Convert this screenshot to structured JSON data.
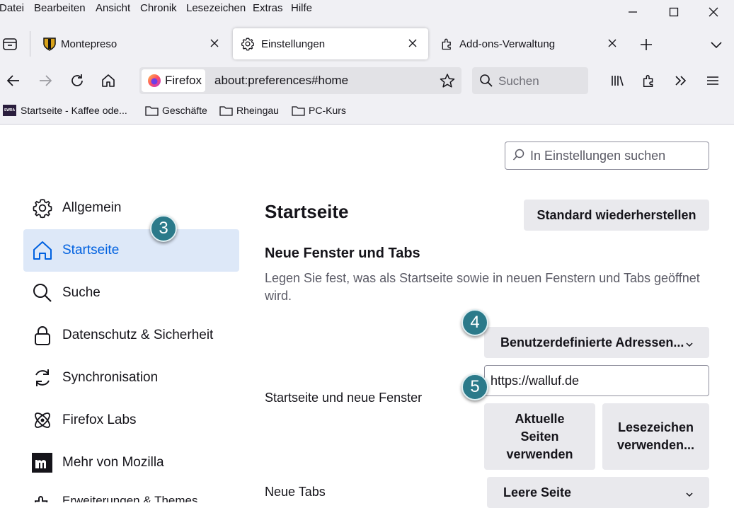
{
  "menu": [
    "Datei",
    "Bearbeiten",
    "Ansicht",
    "Chronik",
    "Lesezeichen",
    "Extras",
    "Hilfe"
  ],
  "tabs": [
    {
      "label": "Montepreso"
    },
    {
      "label": "Einstellungen"
    },
    {
      "label": "Add-ons-Verwaltung"
    }
  ],
  "urlbar": {
    "identity": "Firefox",
    "url": "about:preferences#home"
  },
  "searchbar": {
    "placeholder": "Suchen"
  },
  "bookmarks": [
    "Startseite - Kaffee ode...",
    "Geschäfte",
    "Rheingau",
    "PC-Kurs"
  ],
  "bookmark_favicon_text": "SWRA",
  "prefs_search": {
    "placeholder": "In Einstellungen suchen"
  },
  "categories": [
    {
      "label": "Allgemein"
    },
    {
      "label": "Startseite"
    },
    {
      "label": "Suche"
    },
    {
      "label": "Datenschutz & Sicherheit"
    },
    {
      "label": "Synchronisation"
    },
    {
      "label": "Firefox Labs"
    },
    {
      "label": "Mehr von Mozilla"
    },
    {
      "label": "Erweiterungen & Themes"
    }
  ],
  "main": {
    "title": "Startseite",
    "restore_button": "Standard wiederherstellen",
    "section_title": "Neue Fenster und Tabs",
    "section_desc": "Legen Sie fest, was als Startseite sowie in neuen Fenstern und Tabs geöffnet wird.",
    "homepage_label": "Startseite und neue Fenster",
    "homepage_mode": "Benutzerdefinierte Adressen...",
    "homepage_url": "https://walluf.de",
    "use_current_button": "Aktuelle Seiten verwenden",
    "use_bookmark_button": "Lesezeichen verwenden...",
    "newtabs_label": "Neue Tabs",
    "newtabs_mode": "Leere Seite"
  },
  "badges": [
    "3",
    "4",
    "5"
  ],
  "colors": {
    "accent": "#0061e0",
    "badge": "#2b7a8a",
    "selected_bg": "#dde8f8"
  }
}
